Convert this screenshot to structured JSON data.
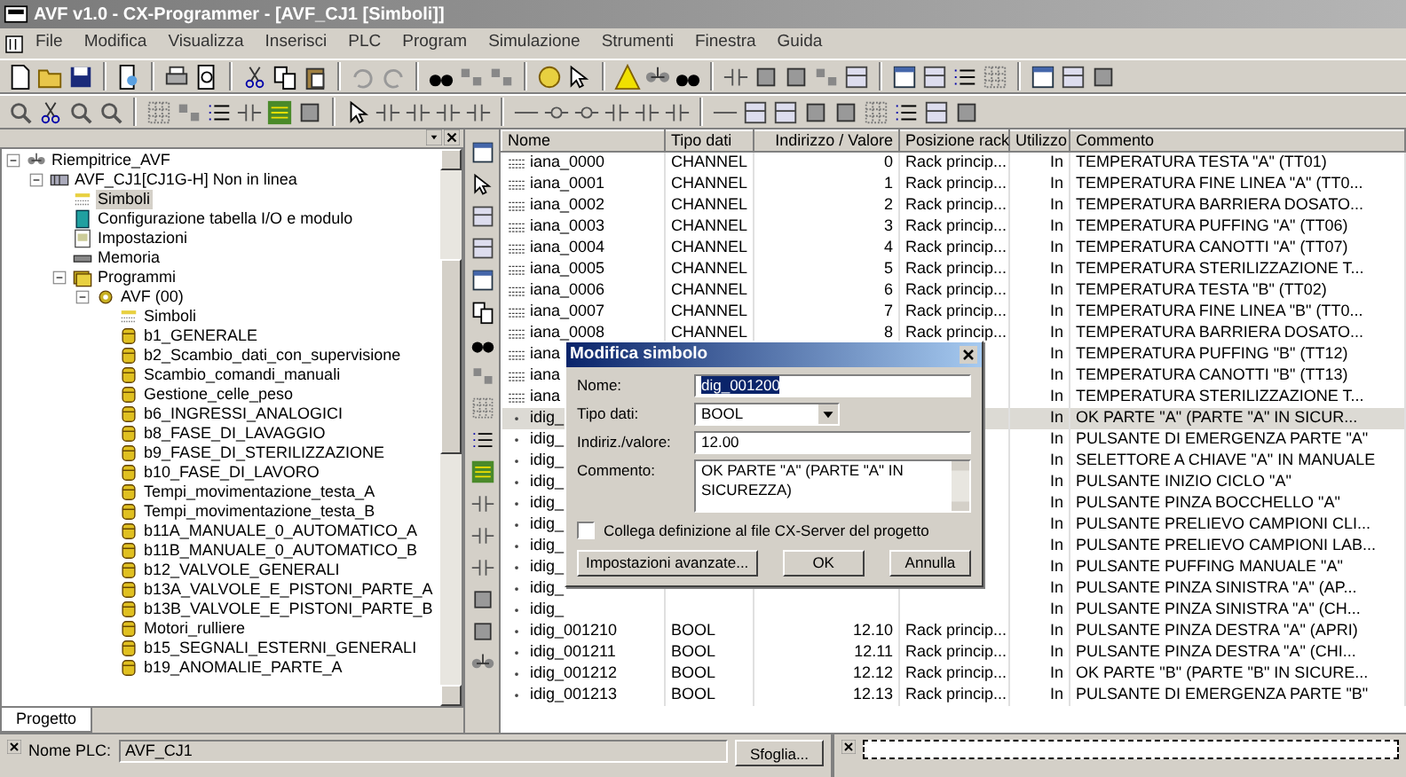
{
  "window": {
    "title": "AVF v1.0 - CX-Programmer - [AVF_CJ1 [Simboli]]"
  },
  "menu": [
    "File",
    "Modifica",
    "Visualizza",
    "Inserisci",
    "PLC",
    "Program",
    "Simulazione",
    "Strumenti",
    "Finestra",
    "Guida"
  ],
  "project_tree": {
    "tab": "Progetto",
    "items": [
      {
        "label": "Riempitrice_AVF",
        "kind": "project",
        "expanded": true,
        "selected": false,
        "children": [
          {
            "label": "AVF_CJ1[CJ1G-H] Non in linea",
            "kind": "plc",
            "expanded": true,
            "selected": false,
            "children": [
              {
                "label": "Simboli",
                "kind": "symbols",
                "selected": true
              },
              {
                "label": "Configurazione tabella I/O e modulo",
                "kind": "io",
                "selected": false
              },
              {
                "label": "Impostazioni",
                "kind": "settings",
                "selected": false
              },
              {
                "label": "Memoria",
                "kind": "memory",
                "selected": false
              },
              {
                "label": "Programmi",
                "kind": "programs",
                "expanded": true,
                "selected": false,
                "children": [
                  {
                    "label": "AVF (00)",
                    "kind": "program",
                    "expanded": true,
                    "selected": false,
                    "children": [
                      {
                        "label": "Simboli",
                        "kind": "symbols",
                        "selected": false
                      },
                      {
                        "label": "b1_GENERALE",
                        "kind": "section",
                        "selected": false
                      },
                      {
                        "label": "b2_Scambio_dati_con_supervisione",
                        "kind": "section",
                        "selected": false
                      },
                      {
                        "label": "Scambio_comandi_manuali",
                        "kind": "section",
                        "selected": false
                      },
                      {
                        "label": "Gestione_celle_peso",
                        "kind": "section",
                        "selected": false
                      },
                      {
                        "label": "b6_INGRESSI_ANALOGICI",
                        "kind": "section",
                        "selected": false
                      },
                      {
                        "label": "b8_FASE_DI_LAVAGGIO",
                        "kind": "section",
                        "selected": false
                      },
                      {
                        "label": "b9_FASE_DI_STERILIZZAZIONE",
                        "kind": "section",
                        "selected": false
                      },
                      {
                        "label": "b10_FASE_DI_LAVORO",
                        "kind": "section",
                        "selected": false
                      },
                      {
                        "label": "Tempi_movimentazione_testa_A",
                        "kind": "section",
                        "selected": false
                      },
                      {
                        "label": "Tempi_movimentazione_testa_B",
                        "kind": "section",
                        "selected": false
                      },
                      {
                        "label": "b11A_MANUALE_0_AUTOMATICO_A",
                        "kind": "section",
                        "selected": false
                      },
                      {
                        "label": "b11B_MANUALE_0_AUTOMATICO_B",
                        "kind": "section",
                        "selected": false
                      },
                      {
                        "label": "b12_VALVOLE_GENERALI",
                        "kind": "section",
                        "selected": false
                      },
                      {
                        "label": "b13A_VALVOLE_E_PISTONI_PARTE_A",
                        "kind": "section",
                        "selected": false
                      },
                      {
                        "label": "b13B_VALVOLE_E_PISTONI_PARTE_B",
                        "kind": "section",
                        "selected": false
                      },
                      {
                        "label": "Motori_rulliere",
                        "kind": "section",
                        "selected": false
                      },
                      {
                        "label": "b15_SEGNALI_ESTERNI_GENERALI",
                        "kind": "section",
                        "selected": false
                      },
                      {
                        "label": "b19_ANOMALIE_PARTE_A",
                        "kind": "section",
                        "selected": false
                      }
                    ]
                  }
                ]
              }
            ]
          }
        ]
      }
    ]
  },
  "table": {
    "columns": [
      "Nome",
      "Tipo dati",
      "Indirizzo / Valore",
      "Posizione rack",
      "Utilizzo",
      "Commento"
    ],
    "rows": [
      {
        "kind": "channel",
        "selected": false,
        "name": "iana_0000",
        "type": "CHANNEL",
        "address": "0",
        "rack": "Rack princip...",
        "usage": "In",
        "comment": "TEMPERATURA TESTA \"A\" (TT01)"
      },
      {
        "kind": "channel",
        "selected": false,
        "name": "iana_0001",
        "type": "CHANNEL",
        "address": "1",
        "rack": "Rack princip...",
        "usage": "In",
        "comment": "TEMPERATURA FINE LINEA \"A\" (TT0..."
      },
      {
        "kind": "channel",
        "selected": false,
        "name": "iana_0002",
        "type": "CHANNEL",
        "address": "2",
        "rack": "Rack princip...",
        "usage": "In",
        "comment": "TEMPERATURA BARRIERA DOSATO..."
      },
      {
        "kind": "channel",
        "selected": false,
        "name": "iana_0003",
        "type": "CHANNEL",
        "address": "3",
        "rack": "Rack princip...",
        "usage": "In",
        "comment": "TEMPERATURA PUFFING \"A\" (TT06)"
      },
      {
        "kind": "channel",
        "selected": false,
        "name": "iana_0004",
        "type": "CHANNEL",
        "address": "4",
        "rack": "Rack princip...",
        "usage": "In",
        "comment": "TEMPERATURA CANOTTI \"A\" (TT07)"
      },
      {
        "kind": "channel",
        "selected": false,
        "name": "iana_0005",
        "type": "CHANNEL",
        "address": "5",
        "rack": "Rack princip...",
        "usage": "In",
        "comment": "TEMPERATURA STERILIZZAZIONE T..."
      },
      {
        "kind": "channel",
        "selected": false,
        "name": "iana_0006",
        "type": "CHANNEL",
        "address": "6",
        "rack": "Rack princip...",
        "usage": "In",
        "comment": "TEMPERATURA TESTA \"B\" (TT02)"
      },
      {
        "kind": "channel",
        "selected": false,
        "name": "iana_0007",
        "type": "CHANNEL",
        "address": "7",
        "rack": "Rack princip...",
        "usage": "In",
        "comment": "TEMPERATURA FINE LINEA \"B\" (TT0..."
      },
      {
        "kind": "channel",
        "selected": false,
        "name": "iana_0008",
        "type": "CHANNEL",
        "address": "8",
        "rack": "Rack princip...",
        "usage": "In",
        "comment": "TEMPERATURA BARRIERA DOSATO..."
      },
      {
        "kind": "channel",
        "selected": false,
        "name": "iana",
        "usage": "In",
        "comment": "TEMPERATURA PUFFING \"B\" (TT12)"
      },
      {
        "kind": "channel",
        "selected": false,
        "name": "iana",
        "usage": "In",
        "comment": "TEMPERATURA CANOTTI \"B\" (TT13)"
      },
      {
        "kind": "channel",
        "selected": false,
        "name": "iana",
        "usage": "In",
        "comment": "TEMPERATURA STERILIZZAZIONE T..."
      },
      {
        "kind": "bit",
        "selected": true,
        "name": "idig_",
        "usage": "In",
        "comment": "OK PARTE \"A\" (PARTE \"A\" IN SICUR..."
      },
      {
        "kind": "bit",
        "selected": false,
        "name": "idig_",
        "usage": "In",
        "comment": "PULSANTE DI EMERGENZA PARTE \"A\""
      },
      {
        "kind": "bit",
        "selected": false,
        "name": "idig_",
        "usage": "In",
        "comment": "SELETTORE A CHIAVE \"A\" IN MANUALE"
      },
      {
        "kind": "bit",
        "selected": false,
        "name": "idig_",
        "usage": "In",
        "comment": "PULSANTE INIZIO CICLO \"A\""
      },
      {
        "kind": "bit",
        "selected": false,
        "name": "idig_",
        "usage": "In",
        "comment": "PULSANTE PINZA BOCCHELLO \"A\""
      },
      {
        "kind": "bit",
        "selected": false,
        "name": "idig_",
        "usage": "In",
        "comment": "PULSANTE PRELIEVO CAMPIONI CLI..."
      },
      {
        "kind": "bit",
        "selected": false,
        "name": "idig_",
        "usage": "In",
        "comment": "PULSANTE PRELIEVO CAMPIONI LAB..."
      },
      {
        "kind": "bit",
        "selected": false,
        "name": "idig_",
        "usage": "In",
        "comment": "PULSANTE PUFFING MANUALE \"A\""
      },
      {
        "kind": "bit",
        "selected": false,
        "name": "idig_",
        "usage": "In",
        "comment": "PULSANTE PINZA SINISTRA \"A\"  (AP..."
      },
      {
        "kind": "bit",
        "selected": false,
        "name": "idig_",
        "usage": "In",
        "comment": "PULSANTE PINZA SINISTRA \"A\"  (CH..."
      },
      {
        "kind": "bit",
        "selected": false,
        "name": "idig_001210",
        "type": "BOOL",
        "address": "12.10",
        "rack": "Rack princip...",
        "usage": "In",
        "comment": "PULSANTE PINZA DESTRA \"A\"  (APRI)"
      },
      {
        "kind": "bit",
        "selected": false,
        "name": "idig_001211",
        "type": "BOOL",
        "address": "12.11",
        "rack": "Rack princip...",
        "usage": "In",
        "comment": "PULSANTE PINZA DESTRA \"A\"  (CHI..."
      },
      {
        "kind": "bit",
        "selected": false,
        "name": "idig_001212",
        "type": "BOOL",
        "address": "12.12",
        "rack": "Rack princip...",
        "usage": "In",
        "comment": "OK PARTE \"B\" (PARTE \"B\" IN SICURE..."
      },
      {
        "kind": "bit",
        "selected": false,
        "name": "idig_001213",
        "type": "BOOL",
        "address": "12.13",
        "rack": "Rack princip...",
        "usage": "In",
        "comment": "PULSANTE DI EMERGENZA PARTE \"B\""
      }
    ]
  },
  "dialog": {
    "title": "Modifica simbolo",
    "name": {
      "label": "Nome:",
      "value": "dig_001200"
    },
    "type": {
      "label": "Tipo dati:",
      "value": "BOOL"
    },
    "address": {
      "label": "Indiriz./valore:",
      "value": "12.00"
    },
    "comment": {
      "label": "Commento:",
      "value": "OK PARTE \"A\" (PARTE \"A\" IN SICUREZZA)"
    },
    "link": {
      "label": "Collega definizione al file CX-Server del progetto",
      "checked": false
    },
    "buttons": [
      "Impostazioni avanzate...",
      "OK",
      "Annulla"
    ]
  },
  "bottom_panel": {
    "plc_name": {
      "label": "Nome PLC:",
      "value": "AVF_CJ1"
    },
    "browse_button": "Sfoglia..."
  }
}
